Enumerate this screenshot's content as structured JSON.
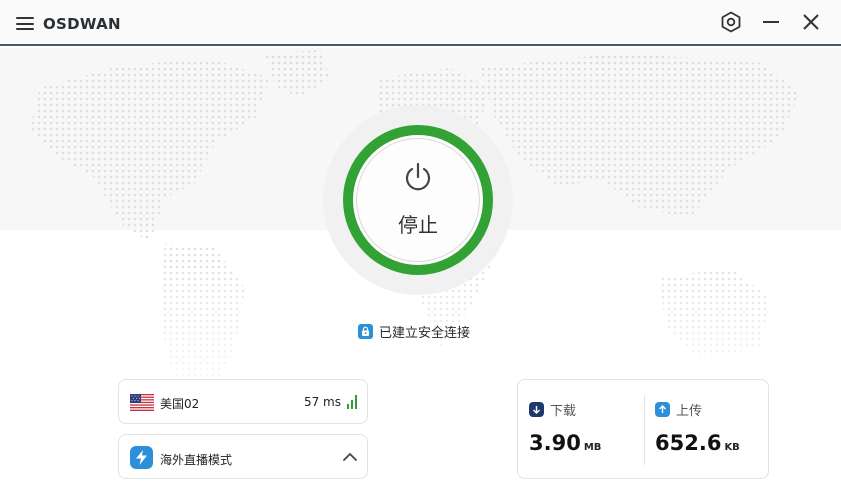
{
  "app": {
    "title": "OSDWAN"
  },
  "window": {
    "icons": {
      "menu": "menu-icon",
      "settings": "settings-hex-icon",
      "minimize": "minimize-icon",
      "close": "close-icon"
    }
  },
  "power": {
    "label": "停止",
    "ring_color": "#33a235",
    "icon": "power-icon"
  },
  "status": {
    "text": "已建立安全连接",
    "icon": "lock-icon",
    "color": "#2d8fd9"
  },
  "server": {
    "name": "美国02",
    "ping": "57 ms",
    "flag": "us-flag-icon",
    "signal_color": "#2e9e3a"
  },
  "mode": {
    "name": "海外直播模式",
    "icon": "lightning-icon",
    "expanded": true
  },
  "traffic": {
    "download": {
      "label": "下载",
      "value": "3.90",
      "unit": "MB",
      "icon_color": "#1d3a6b"
    },
    "upload": {
      "label": "上传",
      "value": "652.6",
      "unit": "KB",
      "icon_color": "#2d8fd9"
    }
  }
}
